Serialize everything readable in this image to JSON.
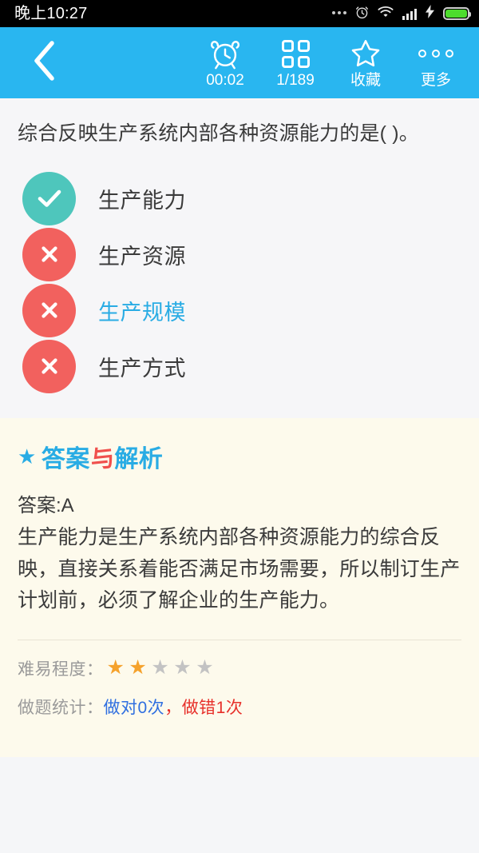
{
  "status_bar": {
    "clock": "晚上10:27",
    "icons": [
      "more-dots-icon",
      "alarm-icon",
      "wifi-icon",
      "signal-icon",
      "charging-icon",
      "battery-icon"
    ]
  },
  "header": {
    "back_icon": "chevron-left-icon",
    "accent_color": "#29b6f0",
    "actions": [
      {
        "icon": "alarm-clock-icon",
        "label": "00:02"
      },
      {
        "icon": "grid-icon",
        "label": "1/189"
      },
      {
        "icon": "star-outline-icon",
        "label": "收藏"
      },
      {
        "icon": "more-horizontal-icon",
        "label": "更多"
      }
    ]
  },
  "question": {
    "text": "综合反映生产系统内部各种资源能力的是(  )。",
    "options": [
      {
        "label": "生产能力",
        "state": "correct",
        "mark": "✓",
        "selected": false
      },
      {
        "label": "生产资源",
        "state": "wrong",
        "mark": "✕",
        "selected": false
      },
      {
        "label": "生产规模",
        "state": "wrong",
        "mark": "✕",
        "selected": true
      },
      {
        "label": "生产方式",
        "state": "wrong",
        "mark": "✕",
        "selected": false
      }
    ]
  },
  "answer_panel": {
    "heading_star": "★",
    "heading_part1": "答案",
    "heading_part2": "与",
    "heading_part3": "解析",
    "answer_key": "答案:A",
    "explanation": "生产能力是生产系统内部各种资源能力的综合反映，直接关系着能否满足市场需要，所以制订生产计划前，必须了解企业的生产能力。",
    "difficulty_label": "难易程度：",
    "difficulty_filled": 2,
    "difficulty_total": 5,
    "stats_label": "做题统计：",
    "stats_correct": "做对0次",
    "stats_separator": "，",
    "stats_wrong": "做错1次",
    "colors": {
      "panel_bg": "#fdfaec",
      "heading_blue": "#29ace4",
      "heading_red": "#f0504c",
      "star_on": "#f5a22c",
      "star_off": "#c3c3c3",
      "stat_right": "#2f6fe0",
      "stat_wrong": "#e7302a"
    }
  }
}
